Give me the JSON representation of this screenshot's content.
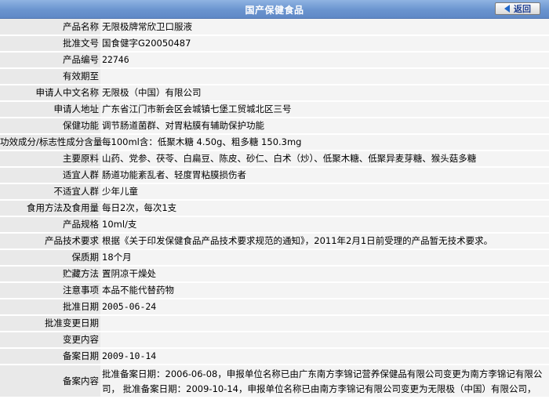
{
  "header": {
    "title": "国产保健食品",
    "back_label": "返回"
  },
  "rows": [
    {
      "label": "产品名称",
      "value": "无限极牌常欣卫口服液"
    },
    {
      "label": "批准文号",
      "value": "国食健字G20050487"
    },
    {
      "label": "产品编号",
      "value": "22746"
    },
    {
      "label": "有效期至",
      "value": ""
    },
    {
      "label": "申请人中文名称",
      "value": "无限极（中国）有限公司"
    },
    {
      "label": "申请人地址",
      "value": "广东省江门市新会区会城镇七堡工贸城北区三号"
    },
    {
      "label": "保健功能",
      "value": "调节肠道菌群、对胃粘膜有辅助保护功能"
    },
    {
      "label": "功效成分/标志性成分含量",
      "value": "每100ml含：低聚木糖 4.50g、粗多糖 150.3mg"
    },
    {
      "label": "主要原料",
      "value": "山药、党参、茯苓、白扁豆、陈皮、砂仁、白术（炒）、低聚木糖、低聚异麦芽糖、猴头菇多糖"
    },
    {
      "label": "适宜人群",
      "value": "肠道功能紊乱者、轻度胃粘膜损伤者"
    },
    {
      "label": "不适宜人群",
      "value": "少年儿童"
    },
    {
      "label": "食用方法及食用量",
      "value": "每日2次，每次1支"
    },
    {
      "label": "产品规格",
      "value": "10ml/支"
    },
    {
      "label": "产品技术要求",
      "value": "根据《关于印发保健食品产品技术要求规范的通知》，2011年2月1日前受理的产品暂无技术要求。"
    },
    {
      "label": "保质期",
      "value": "18个月"
    },
    {
      "label": "贮藏方法",
      "value": "置阴凉干燥处"
    },
    {
      "label": "注意事项",
      "value": "本品不能代替药物"
    },
    {
      "label": "批准日期",
      "value": "2005-06-24"
    },
    {
      "label": "批准变更日期",
      "value": ""
    },
    {
      "label": "变更内容",
      "value": ""
    },
    {
      "label": "备案日期",
      "value": "2009-10-14"
    },
    {
      "label": "备案内容",
      "value": "批准备案日期：2006-06-08，申报单位名称已由广东南方李锦记营养保健品有限公司变更为南方李锦记有限公司， 批准备案日期：2009-10-14，申报单位名称已由南方李锦记有限公司变更为无限极（中国）有限公司，"
    }
  ]
}
